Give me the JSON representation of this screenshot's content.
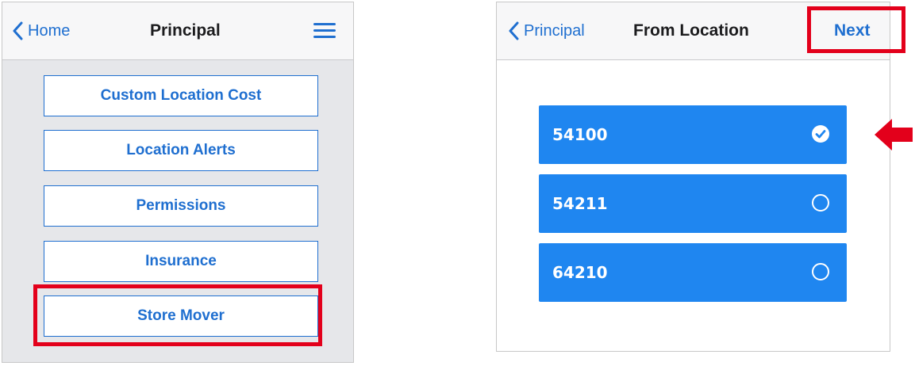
{
  "left_screen": {
    "navbar": {
      "back_label": "Home",
      "title": "Principal",
      "menu_icon": "hamburger-menu-icon"
    },
    "menu_buttons": [
      {
        "label": "Custom Location Cost"
      },
      {
        "label": "Location Alerts"
      },
      {
        "label": "Permissions"
      },
      {
        "label": "Insurance"
      },
      {
        "label": "Store Mover",
        "highlighted": true
      }
    ]
  },
  "right_screen": {
    "navbar": {
      "back_label": "Principal",
      "title": "From Location",
      "next_label": "Next",
      "next_highlighted": true
    },
    "locations": [
      {
        "label": "54100",
        "selected": true
      },
      {
        "label": "54211",
        "selected": false
      },
      {
        "label": "64210",
        "selected": false
      }
    ]
  },
  "annotations": {
    "highlight_color": "#e3001b",
    "pointer": "red-arrow-pointing-left-at-selected-location"
  },
  "colors": {
    "accent": "#1f6fd0",
    "option_fill": "#1f86f0",
    "left_background": "#e6e7ea"
  }
}
